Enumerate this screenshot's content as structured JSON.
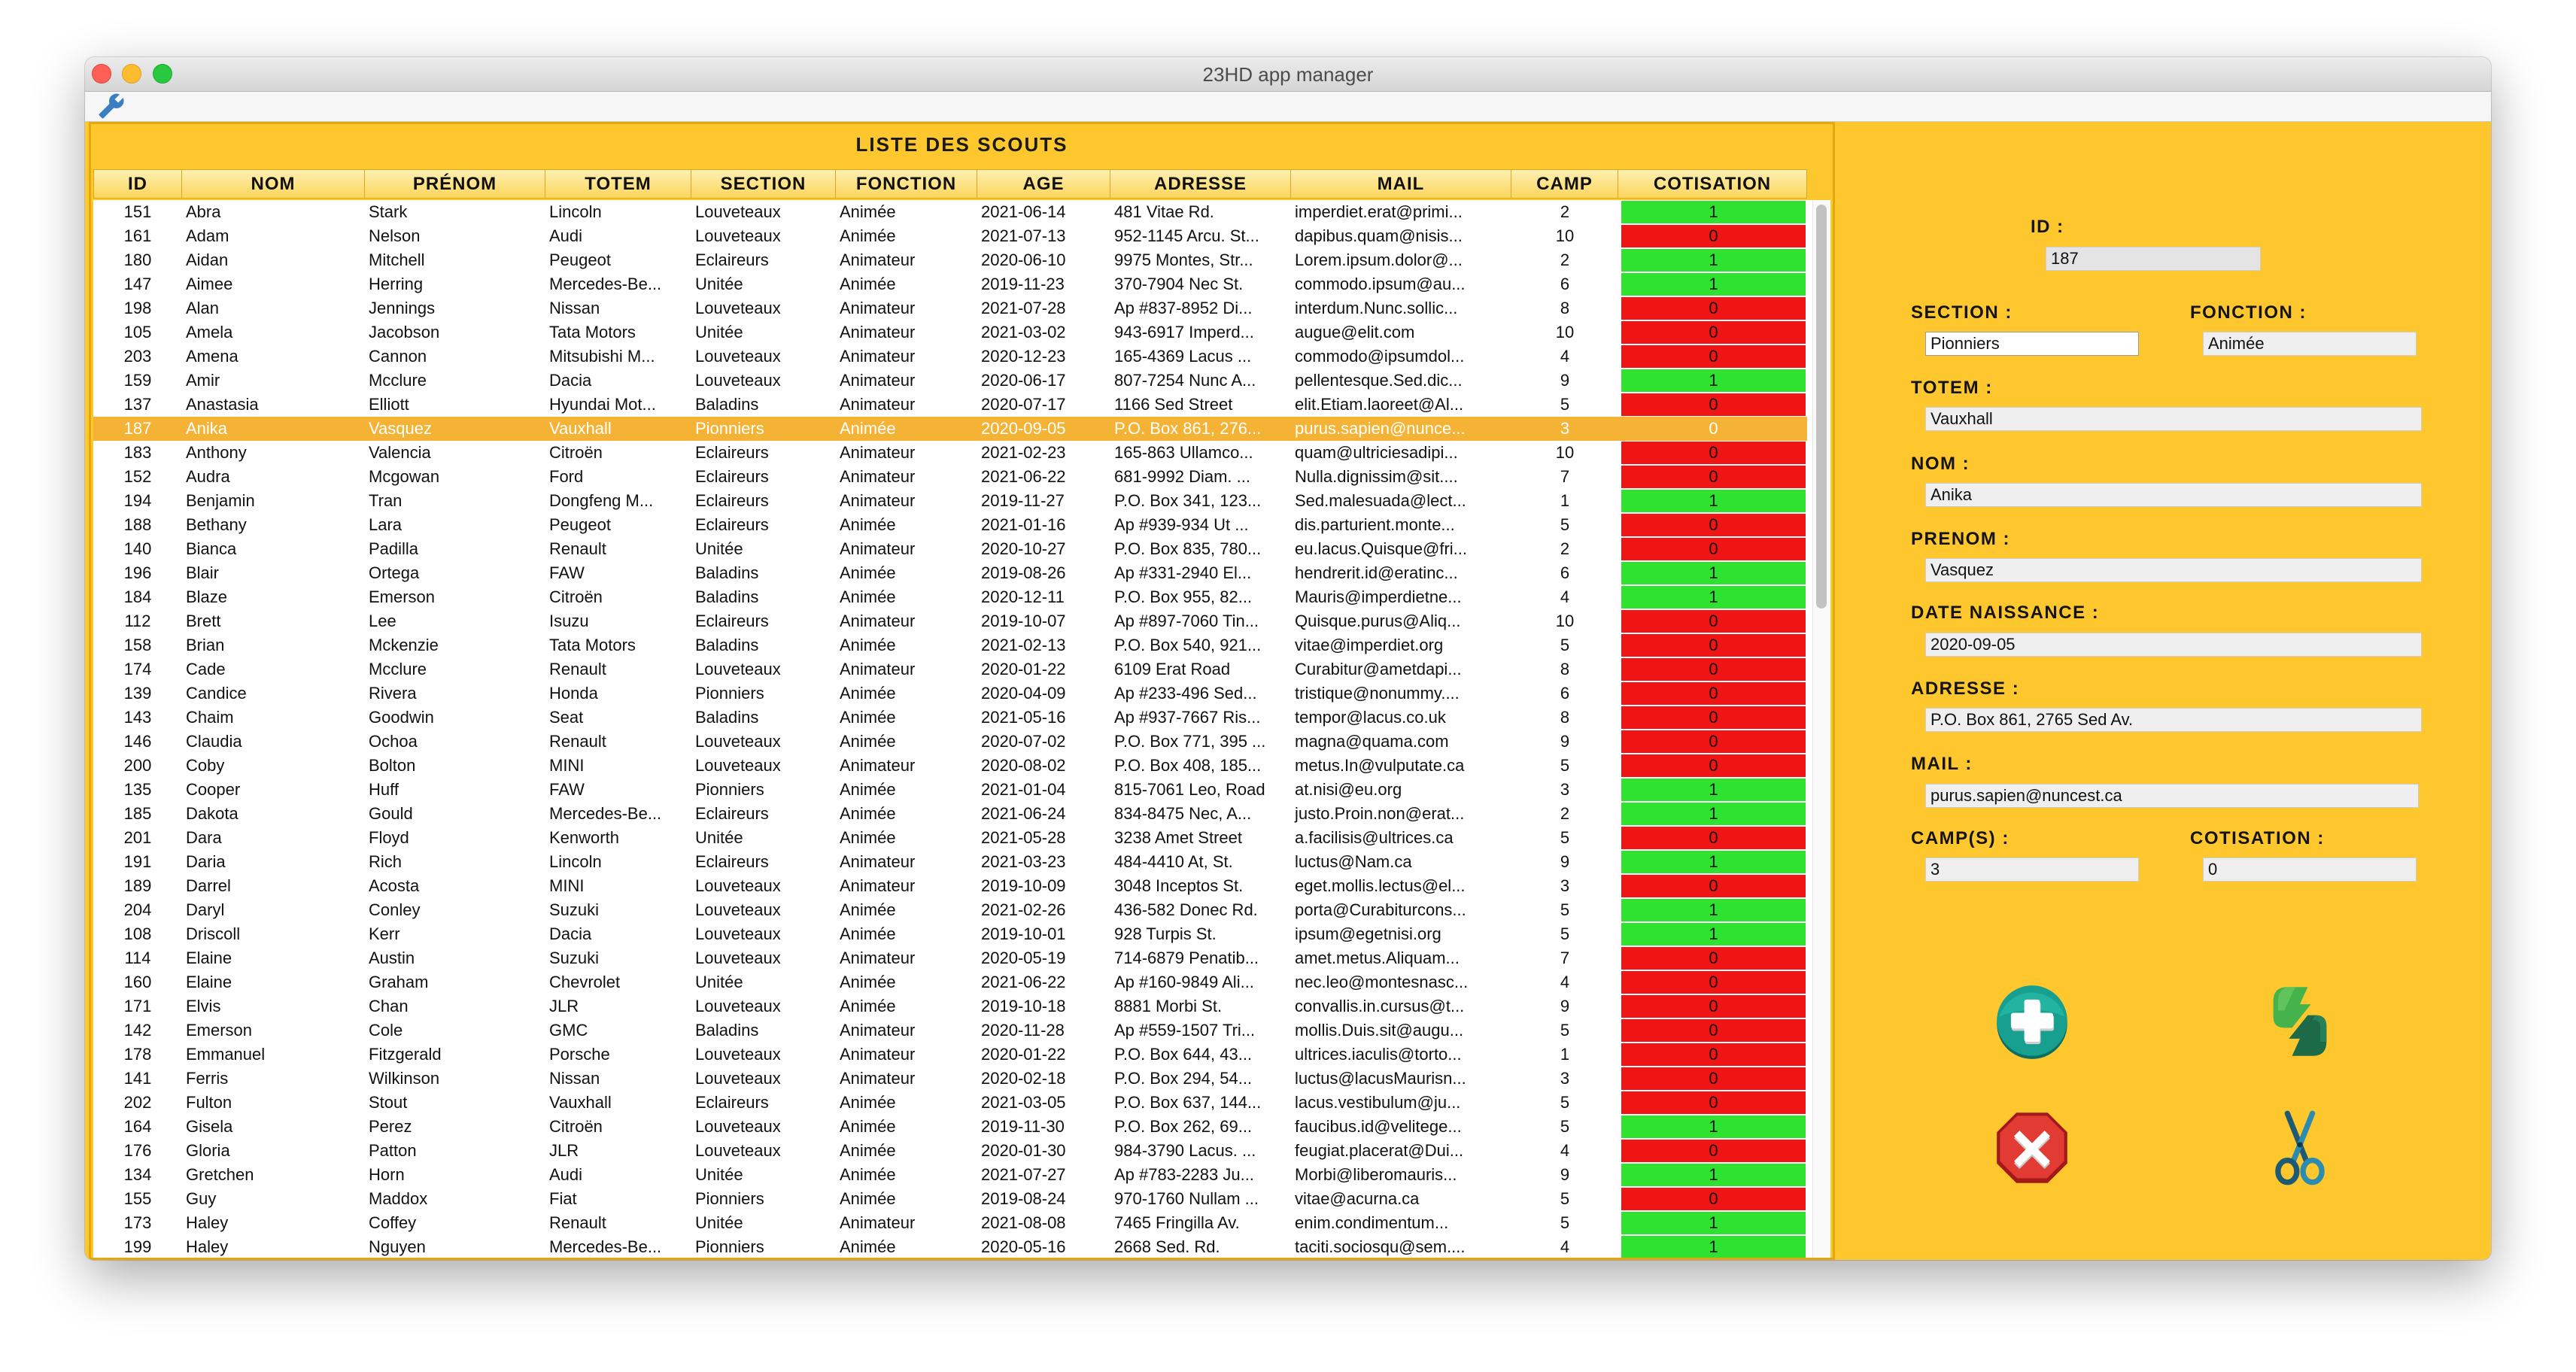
{
  "window": {
    "title": "23HD app manager"
  },
  "toolbar": {
    "icon": "wrench-icon"
  },
  "table": {
    "title": "LISTE DES SCOUTS",
    "columns": [
      "ID",
      "NOM",
      "PRÉNOM",
      "TOTEM",
      "SECTION",
      "FONCTION",
      "AGE",
      "ADRESSE",
      "MAIL",
      "CAMP",
      "COTISATION"
    ],
    "selected_row_id": "187",
    "rows": [
      [
        "151",
        "Abra",
        "Stark",
        "Lincoln",
        "Louveteaux",
        "Animée",
        "2021-06-14",
        "481 Vitae Rd.",
        "imperdiet.erat@primi...",
        "2",
        "1"
      ],
      [
        "161",
        "Adam",
        "Nelson",
        "Audi",
        "Louveteaux",
        "Animée",
        "2021-07-13",
        "952-1145 Arcu. St...",
        "dapibus.quam@nisis...",
        "10",
        "0"
      ],
      [
        "180",
        "Aidan",
        "Mitchell",
        "Peugeot",
        "Eclaireurs",
        "Animateur",
        "2020-06-10",
        "9975 Montes, Str...",
        "Lorem.ipsum.dolor@...",
        "2",
        "1"
      ],
      [
        "147",
        "Aimee",
        "Herring",
        "Mercedes-Be...",
        "Unitée",
        "Animée",
        "2019-11-23",
        "370-7904 Nec St.",
        "commodo.ipsum@au...",
        "6",
        "1"
      ],
      [
        "198",
        "Alan",
        "Jennings",
        "Nissan",
        "Louveteaux",
        "Animateur",
        "2021-07-28",
        "Ap #837-8952 Di...",
        "interdum.Nunc.sollic...",
        "8",
        "0"
      ],
      [
        "105",
        "Amela",
        "Jacobson",
        "Tata Motors",
        "Unitée",
        "Animateur",
        "2021-03-02",
        "943-6917 Imperd...",
        "augue@elit.com",
        "10",
        "0"
      ],
      [
        "203",
        "Amena",
        "Cannon",
        "Mitsubishi M...",
        "Louveteaux",
        "Animateur",
        "2020-12-23",
        "165-4369 Lacus ...",
        "commodo@ipsumdol...",
        "4",
        "0"
      ],
      [
        "159",
        "Amir",
        "Mcclure",
        "Dacia",
        "Louveteaux",
        "Animateur",
        "2020-06-17",
        "807-7254 Nunc A...",
        "pellentesque.Sed.dic...",
        "9",
        "1"
      ],
      [
        "137",
        "Anastasia",
        "Elliott",
        "Hyundai Mot...",
        "Baladins",
        "Animateur",
        "2020-07-17",
        "1166 Sed Street",
        "elit.Etiam.laoreet@Al...",
        "5",
        "0"
      ],
      [
        "187",
        "Anika",
        "Vasquez",
        "Vauxhall",
        "Pionniers",
        "Animée",
        "2020-09-05",
        "P.O. Box 861, 276...",
        "purus.sapien@nunce...",
        "3",
        "0"
      ],
      [
        "183",
        "Anthony",
        "Valencia",
        "Citroën",
        "Eclaireurs",
        "Animateur",
        "2021-02-23",
        "165-863 Ullamco...",
        "quam@ultriciesadipi...",
        "10",
        "0"
      ],
      [
        "152",
        "Audra",
        "Mcgowan",
        "Ford",
        "Eclaireurs",
        "Animateur",
        "2021-06-22",
        "681-9992 Diam. ...",
        "Nulla.dignissim@sit....",
        "7",
        "0"
      ],
      [
        "194",
        "Benjamin",
        "Tran",
        "Dongfeng M...",
        "Eclaireurs",
        "Animateur",
        "2019-11-27",
        "P.O. Box 341, 123...",
        "Sed.malesuada@lect...",
        "1",
        "1"
      ],
      [
        "188",
        "Bethany",
        "Lara",
        "Peugeot",
        "Eclaireurs",
        "Animée",
        "2021-01-16",
        "Ap #939-934 Ut ...",
        "dis.parturient.monte...",
        "5",
        "0"
      ],
      [
        "140",
        "Bianca",
        "Padilla",
        "Renault",
        "Unitée",
        "Animateur",
        "2020-10-27",
        "P.O. Box 835, 780...",
        "eu.lacus.Quisque@fri...",
        "2",
        "0"
      ],
      [
        "196",
        "Blair",
        "Ortega",
        "FAW",
        "Baladins",
        "Animée",
        "2019-08-26",
        "Ap #331-2940 El...",
        "hendrerit.id@eratinc...",
        "6",
        "1"
      ],
      [
        "184",
        "Blaze",
        "Emerson",
        "Citroën",
        "Baladins",
        "Animée",
        "2020-12-11",
        "P.O. Box 955, 82...",
        "Mauris@imperdietne...",
        "4",
        "1"
      ],
      [
        "112",
        "Brett",
        "Lee",
        "Isuzu",
        "Eclaireurs",
        "Animateur",
        "2019-10-07",
        "Ap #897-7060 Tin...",
        "Quisque.purus@Aliq...",
        "10",
        "0"
      ],
      [
        "158",
        "Brian",
        "Mckenzie",
        "Tata Motors",
        "Baladins",
        "Animée",
        "2021-02-13",
        "P.O. Box 540, 921...",
        "vitae@imperdiet.org",
        "5",
        "0"
      ],
      [
        "174",
        "Cade",
        "Mcclure",
        "Renault",
        "Louveteaux",
        "Animateur",
        "2020-01-22",
        "6109 Erat Road",
        "Curabitur@ametdapi...",
        "8",
        "0"
      ],
      [
        "139",
        "Candice",
        "Rivera",
        "Honda",
        "Pionniers",
        "Animée",
        "2020-04-09",
        "Ap #233-496 Sed...",
        "tristique@nonummy....",
        "6",
        "0"
      ],
      [
        "143",
        "Chaim",
        "Goodwin",
        "Seat",
        "Baladins",
        "Animée",
        "2021-05-16",
        "Ap #937-7667 Ris...",
        "tempor@lacus.co.uk",
        "8",
        "0"
      ],
      [
        "146",
        "Claudia",
        "Ochoa",
        "Renault",
        "Louveteaux",
        "Animée",
        "2020-07-02",
        "P.O. Box 771, 395 ...",
        "magna@quama.com",
        "9",
        "0"
      ],
      [
        "200",
        "Coby",
        "Bolton",
        "MINI",
        "Louveteaux",
        "Animateur",
        "2020-08-02",
        "P.O. Box 408, 185...",
        "metus.In@vulputate.ca",
        "5",
        "0"
      ],
      [
        "135",
        "Cooper",
        "Huff",
        "FAW",
        "Pionniers",
        "Animée",
        "2021-01-04",
        "815-7061 Leo, Road",
        "at.nisi@eu.org",
        "3",
        "1"
      ],
      [
        "185",
        "Dakota",
        "Gould",
        "Mercedes-Be...",
        "Eclaireurs",
        "Animée",
        "2021-06-24",
        "834-8475 Nec, A...",
        "justo.Proin.non@erat...",
        "2",
        "1"
      ],
      [
        "201",
        "Dara",
        "Floyd",
        "Kenworth",
        "Unitée",
        "Animée",
        "2021-05-28",
        "3238 Amet Street",
        "a.facilisis@ultrices.ca",
        "5",
        "0"
      ],
      [
        "191",
        "Daria",
        "Rich",
        "Lincoln",
        "Eclaireurs",
        "Animateur",
        "2021-03-23",
        "484-4410 At, St.",
        "luctus@Nam.ca",
        "9",
        "1"
      ],
      [
        "189",
        "Darrel",
        "Acosta",
        "MINI",
        "Louveteaux",
        "Animateur",
        "2019-10-09",
        "3048 Inceptos St.",
        "eget.mollis.lectus@el...",
        "3",
        "0"
      ],
      [
        "204",
        "Daryl",
        "Conley",
        "Suzuki",
        "Louveteaux",
        "Animée",
        "2021-02-26",
        "436-582 Donec Rd.",
        "porta@Curabiturcons...",
        "5",
        "1"
      ],
      [
        "108",
        "Driscoll",
        "Kerr",
        "Dacia",
        "Louveteaux",
        "Animée",
        "2019-10-01",
        "928 Turpis St.",
        "ipsum@egetnisi.org",
        "5",
        "1"
      ],
      [
        "114",
        "Elaine",
        "Austin",
        "Suzuki",
        "Louveteaux",
        "Animateur",
        "2020-05-19",
        "714-6879 Penatib...",
        "amet.metus.Aliquam...",
        "7",
        "0"
      ],
      [
        "160",
        "Elaine",
        "Graham",
        "Chevrolet",
        "Unitée",
        "Animée",
        "2021-06-22",
        "Ap #160-9849 Ali...",
        "nec.leo@montesnasc...",
        "4",
        "0"
      ],
      [
        "171",
        "Elvis",
        "Chan",
        "JLR",
        "Louveteaux",
        "Animée",
        "2019-10-18",
        "8881 Morbi St.",
        "convallis.in.cursus@t...",
        "9",
        "0"
      ],
      [
        "142",
        "Emerson",
        "Cole",
        "GMC",
        "Baladins",
        "Animateur",
        "2020-11-28",
        "Ap #559-1507 Tri...",
        "mollis.Duis.sit@augu...",
        "5",
        "0"
      ],
      [
        "178",
        "Emmanuel",
        "Fitzgerald",
        "Porsche",
        "Louveteaux",
        "Animateur",
        "2020-01-22",
        "P.O. Box 644, 43...",
        "ultrices.iaculis@torto...",
        "1",
        "0"
      ],
      [
        "141",
        "Ferris",
        "Wilkinson",
        "Nissan",
        "Louveteaux",
        "Animateur",
        "2020-02-18",
        "P.O. Box 294, 54...",
        "luctus@lacusMaurisn...",
        "3",
        "0"
      ],
      [
        "202",
        "Fulton",
        "Stout",
        "Vauxhall",
        "Eclaireurs",
        "Animée",
        "2021-03-05",
        "P.O. Box 637, 144...",
        "lacus.vestibulum@ju...",
        "5",
        "0"
      ],
      [
        "164",
        "Gisela",
        "Perez",
        "Citroën",
        "Louveteaux",
        "Animée",
        "2019-11-30",
        "P.O. Box 262, 69...",
        "faucibus.id@velitege...",
        "5",
        "1"
      ],
      [
        "176",
        "Gloria",
        "Patton",
        "JLR",
        "Louveteaux",
        "Animée",
        "2020-01-30",
        "984-3790 Lacus. ...",
        "feugiat.placerat@Dui...",
        "4",
        "0"
      ],
      [
        "134",
        "Gretchen",
        "Horn",
        "Audi",
        "Unitée",
        "Animée",
        "2021-07-27",
        "Ap #783-2283 Ju...",
        "Morbi@liberomauris...",
        "9",
        "1"
      ],
      [
        "155",
        "Guy",
        "Maddox",
        "Fiat",
        "Pionniers",
        "Animée",
        "2019-08-24",
        "970-1760 Nullam ...",
        "vitae@acurna.ca",
        "5",
        "0"
      ],
      [
        "173",
        "Haley",
        "Coffey",
        "Renault",
        "Unitée",
        "Animateur",
        "2021-08-08",
        "7465 Fringilla Av.",
        "enim.condimentum...",
        "5",
        "1"
      ],
      [
        "199",
        "Haley",
        "Nguyen",
        "Mercedes-Be...",
        "Pionniers",
        "Animée",
        "2020-05-16",
        "2668 Sed. Rd.",
        "taciti.sociosqu@sem....",
        "4",
        "1"
      ]
    ]
  },
  "form": {
    "id": {
      "label": "ID :",
      "value": "187"
    },
    "section": {
      "label": "SECTION :",
      "value": "Pionniers"
    },
    "fonction": {
      "label": "FONCTION :",
      "value": "Animée"
    },
    "totem": {
      "label": "TOTEM :",
      "value": "Vauxhall"
    },
    "nom": {
      "label": "NOM :",
      "value": "Anika"
    },
    "prenom": {
      "label": "PRENOM :",
      "value": "Vasquez"
    },
    "date_naissance": {
      "label": "DATE NAISSANCE :",
      "value": "2020-09-05"
    },
    "adresse": {
      "label": "ADRESSE :",
      "value": "P.O. Box 861, 2765 Sed Av."
    },
    "mail": {
      "label": "MAIL :",
      "value": "purus.sapien@nuncest.ca"
    },
    "camps": {
      "label": "CAMP(S) :",
      "value": "3"
    },
    "cotisation": {
      "label": "COTISATION :",
      "value": "0"
    }
  },
  "actions": {
    "add_icon": "plus-circle-icon",
    "update_icon": "sync-icon",
    "delete_icon": "delete-octagon-icon",
    "cut_icon": "scissors-icon"
  },
  "colors": {
    "background": "#FEC72E",
    "panel_border": "#E3A90C",
    "selected_row": "#F5B335",
    "paid": "#2FE22F",
    "unpaid": "#F01414"
  }
}
